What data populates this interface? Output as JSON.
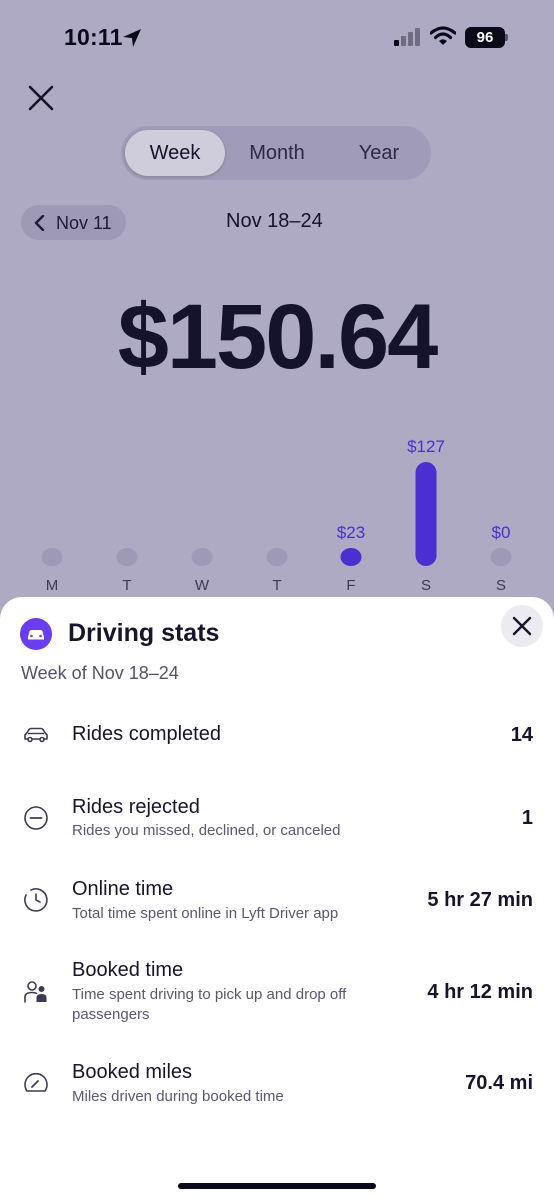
{
  "status_bar": {
    "time": "10:11",
    "battery": "96"
  },
  "period_tabs": [
    {
      "label": "Week",
      "selected": true
    },
    {
      "label": "Month",
      "selected": false
    },
    {
      "label": "Year",
      "selected": false
    }
  ],
  "navigation": {
    "previous_label": "Nov 11",
    "current_range": "Nov 18–24"
  },
  "total_earnings": "$150.64",
  "chart_data": {
    "type": "bar",
    "categories": [
      "M",
      "T",
      "W",
      "T",
      "F",
      "S",
      "S"
    ],
    "values": [
      0,
      0,
      0,
      0,
      23,
      127,
      0
    ],
    "value_labels": [
      "",
      "",
      "",
      "",
      "$23",
      "$127",
      "$0"
    ],
    "colors": {
      "active": "#4b2fd0",
      "empty": "#9d99b6",
      "label": "#4b2fd0"
    }
  },
  "sheet": {
    "title": "Driving stats",
    "subtitle": "Week of Nov 18–24",
    "stats": [
      {
        "icon": "car-icon",
        "label": "Rides completed",
        "description": "",
        "value": "14"
      },
      {
        "icon": "minus-circle-icon",
        "label": "Rides rejected",
        "description": "Rides you missed, declined, or canceled",
        "value": "1"
      },
      {
        "icon": "clock-icon",
        "label": "Online time",
        "description": "Total time spent online in Lyft Driver app",
        "value": "5 hr 27 min"
      },
      {
        "icon": "passengers-icon",
        "label": "Booked time",
        "description": "Time spent driving to pick up and drop off passengers",
        "value": "4 hr 12 min"
      },
      {
        "icon": "speedometer-icon",
        "label": "Booked miles",
        "description": "Miles driven during booked time",
        "value": "70.4 mi"
      }
    ]
  },
  "colors": {
    "accent": "#6a3df0",
    "backdrop": "#aeaac3",
    "text": "#17142d"
  }
}
